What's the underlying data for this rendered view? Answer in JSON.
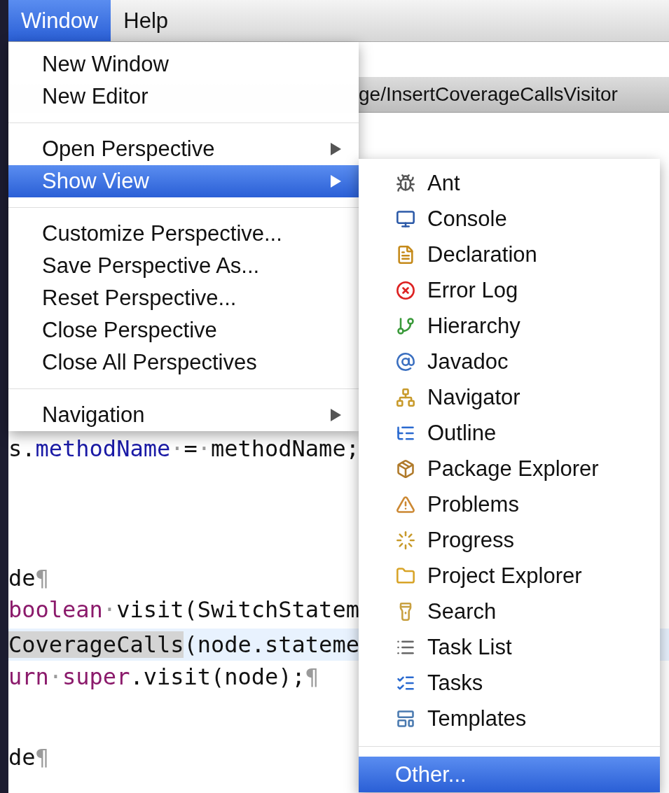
{
  "menubar": [
    {
      "label": "Window",
      "selected": true
    },
    {
      "label": "Help",
      "selected": false
    }
  ],
  "path_bar": {
    "text": "ge/InsertCoverageCallsVisitor"
  },
  "code_lines": [
    {
      "current": false,
      "tokens": [
        {
          "kind": "plain",
          "text": "s."
        },
        {
          "kind": "field",
          "text": "methodName"
        },
        {
          "kind": "ws",
          "text": "·"
        },
        {
          "kind": "plain",
          "text": "="
        },
        {
          "kind": "ws",
          "text": "·"
        },
        {
          "kind": "plain",
          "text": "methodName;"
        }
      ]
    },
    {
      "current": false,
      "tokens": [
        {
          "kind": "plain",
          "text": "de"
        },
        {
          "kind": "ws",
          "text": "¶"
        }
      ]
    },
    {
      "current": false,
      "tokens": [
        {
          "kind": "keyword",
          "text": "boolean"
        },
        {
          "kind": "ws",
          "text": "·"
        },
        {
          "kind": "plain",
          "text": "visit(SwitchStatem"
        }
      ]
    },
    {
      "current": true,
      "tokens": [
        {
          "kind": "highlight",
          "text": "CoverageCalls"
        },
        {
          "kind": "plain",
          "text": "(node.stateme"
        }
      ]
    },
    {
      "current": false,
      "tokens": [
        {
          "kind": "keyword",
          "text": "urn"
        },
        {
          "kind": "ws",
          "text": "·"
        },
        {
          "kind": "keyword",
          "text": "super"
        },
        {
          "kind": "plain",
          "text": ".visit(node);"
        },
        {
          "kind": "ws",
          "text": "¶"
        }
      ]
    },
    {
      "current": false,
      "tokens": [
        {
          "kind": "plain",
          "text": "de"
        },
        {
          "kind": "ws",
          "text": "¶"
        }
      ]
    }
  ],
  "window_menu": [
    {
      "kind": "item",
      "label": "New Window",
      "selected": false,
      "has_submenu": false
    },
    {
      "kind": "item",
      "label": "New Editor",
      "selected": false,
      "has_submenu": false
    },
    {
      "kind": "separator"
    },
    {
      "kind": "item",
      "label": "Open Perspective",
      "selected": false,
      "has_submenu": true
    },
    {
      "kind": "item",
      "label": "Show View",
      "selected": true,
      "has_submenu": true
    },
    {
      "kind": "separator"
    },
    {
      "kind": "item",
      "label": "Customize Perspective...",
      "selected": false,
      "has_submenu": false
    },
    {
      "kind": "item",
      "label": "Save Perspective As...",
      "selected": false,
      "has_submenu": false
    },
    {
      "kind": "item",
      "label": "Reset Perspective...",
      "selected": false,
      "has_submenu": false
    },
    {
      "kind": "item",
      "label": "Close Perspective",
      "selected": false,
      "has_submenu": false
    },
    {
      "kind": "item",
      "label": "Close All Perspectives",
      "selected": false,
      "has_submenu": false
    },
    {
      "kind": "separator"
    },
    {
      "kind": "item",
      "label": "Navigation",
      "selected": false,
      "has_submenu": true
    }
  ],
  "show_view_menu": [
    {
      "kind": "item",
      "label": "Ant",
      "selected": false
    },
    {
      "kind": "item",
      "label": "Console",
      "selected": false
    },
    {
      "kind": "item",
      "label": "Declaration",
      "selected": false
    },
    {
      "kind": "item",
      "label": "Error Log",
      "selected": false
    },
    {
      "kind": "item",
      "label": "Hierarchy",
      "selected": false
    },
    {
      "kind": "item",
      "label": "Javadoc",
      "selected": false
    },
    {
      "kind": "item",
      "label": "Navigator",
      "selected": false
    },
    {
      "kind": "item",
      "label": "Outline",
      "selected": false
    },
    {
      "kind": "item",
      "label": "Package Explorer",
      "selected": false
    },
    {
      "kind": "item",
      "label": "Problems",
      "selected": false
    },
    {
      "kind": "item",
      "label": "Progress",
      "selected": false
    },
    {
      "kind": "item",
      "label": "Project Explorer",
      "selected": false
    },
    {
      "kind": "item",
      "label": "Search",
      "selected": false
    },
    {
      "kind": "item",
      "label": "Task List",
      "selected": false
    },
    {
      "kind": "item",
      "label": "Tasks",
      "selected": false
    },
    {
      "kind": "item",
      "label": "Templates",
      "selected": false
    },
    {
      "kind": "separator"
    },
    {
      "kind": "item",
      "label": "Other...",
      "selected": true
    }
  ]
}
